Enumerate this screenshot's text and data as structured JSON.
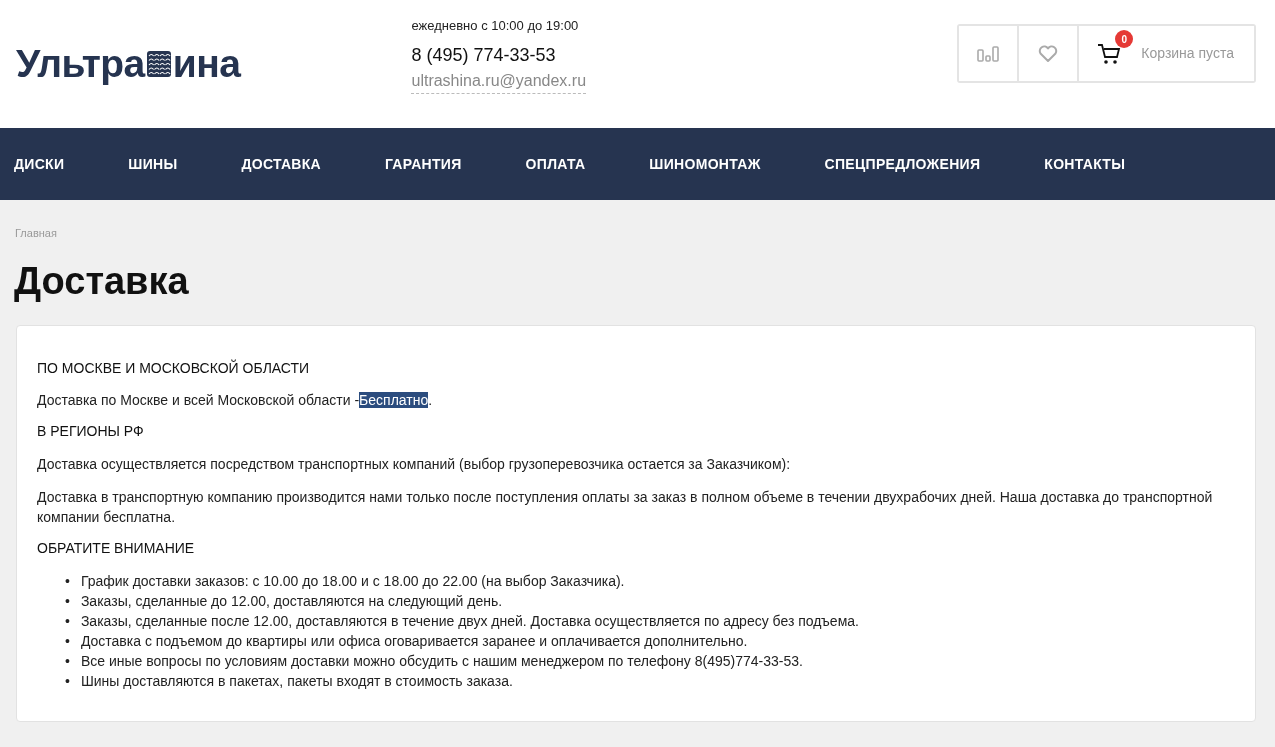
{
  "logo": {
    "before": "Ультра",
    "after": "ина"
  },
  "contacts": {
    "hours": "ежедневно с 10:00 до 19:00",
    "phone": "8 (495) 774-33-53",
    "email": "ultrashina.ru@yandex.ru"
  },
  "cart": {
    "count": "0",
    "label": "Корзина пуста"
  },
  "nav": [
    "ДИСКИ",
    "ШИНЫ",
    "ДОСТАВКА",
    "ГАРАНТИЯ",
    "ОПЛАТА",
    "ШИНОМОНТАЖ",
    "СПЕЦПРЕДЛОЖЕНИЯ",
    "КОНТАКТЫ"
  ],
  "breadcrumb": [
    "Главная"
  ],
  "title": "Доставка",
  "content": [
    {
      "kind": "heading",
      "text": "ПО МОСКВЕ И МОСКОВСКОЙ ОБЛАСТИ"
    },
    {
      "kind": "paragraph",
      "text": "Доставка по Москве и всей Московской области -",
      "highlight": "Бесплатно",
      "after": "."
    },
    {
      "kind": "heading",
      "text": "В РЕГИОНЫ РФ"
    },
    {
      "kind": "paragraph",
      "text": "Доставка осуществляется посредством транспортных компаний (выбор грузоперевозчика остается за Заказчиком):"
    },
    {
      "kind": "paragraph",
      "text": "Доставка в транспортную компанию производится нами только после поступления оплаты за заказ в полном объеме в течении двухрабочих дней. Наша доставка до транспортной компании бесплатна."
    },
    {
      "kind": "heading",
      "text": "ОБРАТИТЕ ВНИМАНИЕ"
    },
    {
      "kind": "list",
      "marker": "•",
      "items": [
        "График доставки заказов: с 10.00 до 18.00 и с 18.00 до 22.00 (на выбор Заказчика).",
        "Заказы, сделанные до 12.00, доставляются на следующий день.",
        "Заказы, сделанные после 12.00, доставляются в течение двух дней. Доставка осуществляется по адресу без подъема.",
        "Доставка с подъемом до квартиры или офиса оговаривается заранее и оплачивается дополнительно.",
        "Все иные вопросы по условиям доставки можно обсудить с нашим менеджером по телефону 8(495)774-33-53.",
        "Шины доставляются в пакетах, пакеты входят в стоимость заказа."
      ]
    }
  ]
}
